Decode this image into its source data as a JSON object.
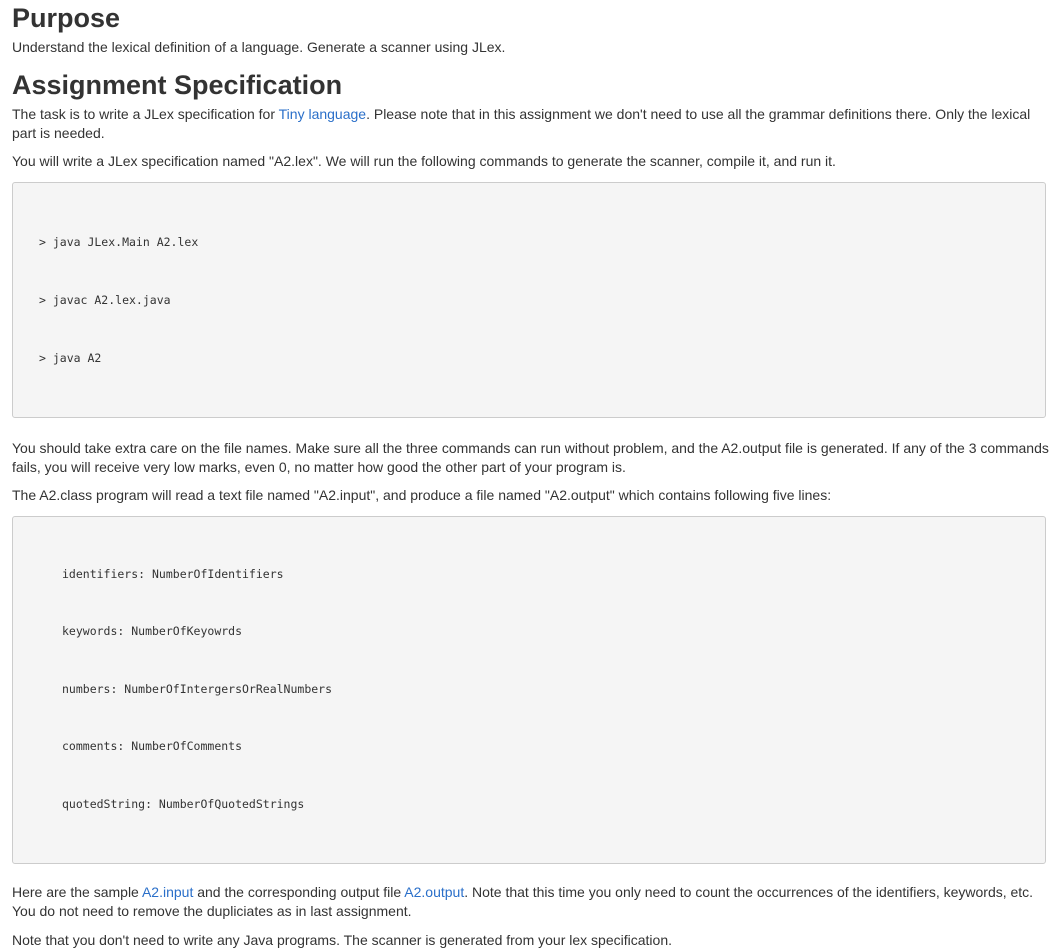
{
  "purpose": {
    "heading": "Purpose",
    "text": "Understand the lexical definition of a language. Generate a scanner using JLex."
  },
  "spec": {
    "heading": "Assignment Specification",
    "p1_before": "The task is to write a JLex specification for ",
    "p1_link": "Tiny language",
    "p1_after": ".  Please note that in this assignment  we don't need to use all the grammar definitions there.  Only the lexical part is needed.",
    "p2": "You will write a JLex specification named \"A2.lex\". We will run the following commands to generate the scanner, compile it, and run it.",
    "commands": [
      "> java JLex.Main A2.lex",
      "> javac A2.lex.java",
      "> java A2"
    ],
    "p3": "You should take extra care on the file names. Make sure all the three commands can run without problem, and the A2.output file is generated. If any of the 3 commands fails, you will receive very low marks, even 0, no matter how good the other part of your program is.",
    "p4": "The A2.class program will read a text file named \"A2.input\", and produce a file named \"A2.output\" which contains following five lines:",
    "output_lines": [
      "identifiers: NumberOfIdentifiers",
      "keywords: NumberOfKeyowrds",
      "numbers: NumberOfIntergersOrRealNumbers",
      "comments: NumberOfComments",
      "quotedString: NumberOfQuotedStrings"
    ],
    "p5_before": "Here are the sample ",
    "p5_link1": "A2.input",
    "p5_middle": " and the corresponding output file ",
    "p5_link2": "A2.output",
    "p5_after": ". Note that this time you only need to count the occurrences of the identifiers, keywords, etc. You do not need to remove the dupliciates as in last assignment.",
    "p6": "Note that you don't need to write any Java programs. The scanner is generated from your lex specification."
  },
  "colors": {
    "link": "#2a6fc9",
    "text": "#333333",
    "code_bg": "#f5f5f5",
    "code_border": "#cccccc"
  }
}
